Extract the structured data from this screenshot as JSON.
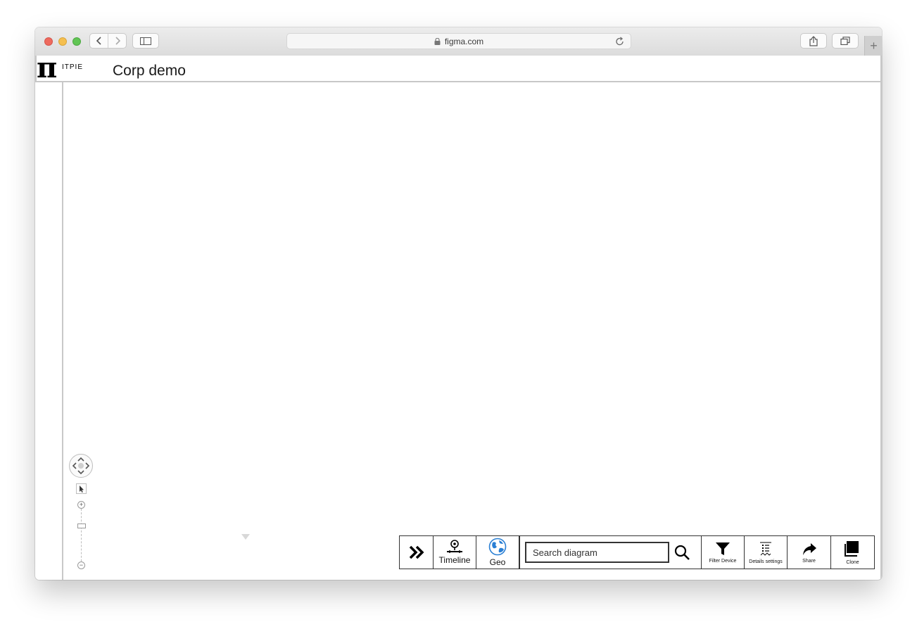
{
  "browser": {
    "address": "figma.com",
    "icons": {
      "lock": "lock-icon",
      "reload": "reload-icon",
      "back": "chevron-left-icon",
      "forward": "chevron-right-icon",
      "sidebar": "sidebar-icon",
      "share": "share-icon",
      "tabs": "tabs-overview-icon",
      "new_tab": "plus-icon"
    }
  },
  "app": {
    "logo_text": "ITPIE",
    "logo_symbol": "π",
    "title": "Corp demo"
  },
  "map_controls": {
    "zoom_in": "+",
    "zoom_out": "−"
  },
  "bottom_toolbar": {
    "expand_icon": "double-chevron-right-icon",
    "timeline_label": "Timeline",
    "geo_label": "Geo",
    "search_placeholder": "Search diagram",
    "filter_label": "Filter Device",
    "details_label": "Details settings",
    "share_label": "Share",
    "clone_label": "Clone"
  },
  "colors": {
    "accent_geo": "#2a7fd4",
    "border": "#333333"
  }
}
